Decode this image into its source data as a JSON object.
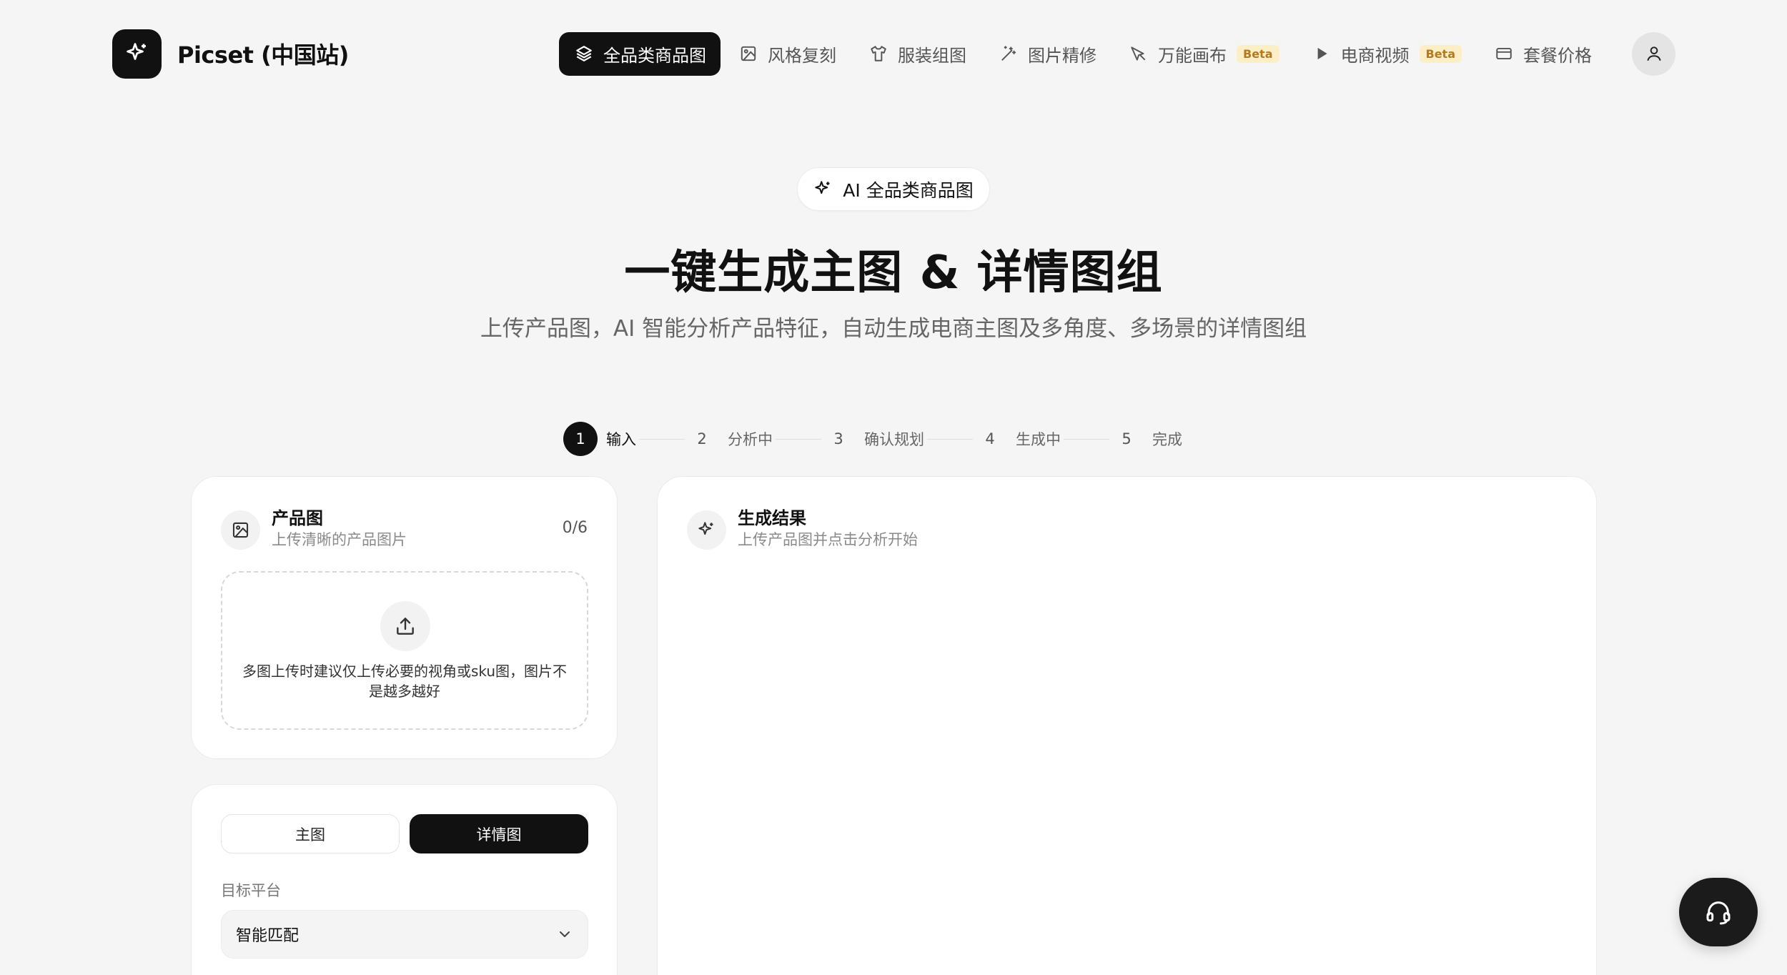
{
  "brand": {
    "name": "Picset (中国站)"
  },
  "nav": {
    "items": [
      {
        "label": "全品类商品图",
        "active": true,
        "icon": "layers-icon"
      },
      {
        "label": "风格复刻",
        "icon": "image-icon"
      },
      {
        "label": "服装组图",
        "icon": "shirt-icon"
      },
      {
        "label": "图片精修",
        "icon": "magic-wand-icon"
      },
      {
        "label": "万能画布",
        "badge": "Beta",
        "icon": "pen-icon"
      },
      {
        "label": "电商视频",
        "badge": "Beta",
        "icon": "play-icon"
      },
      {
        "label": "套餐价格",
        "icon": "card-icon"
      }
    ]
  },
  "hero": {
    "pill": "AI 全品类商品图",
    "title": "一键生成主图 & 详情图组",
    "subtitle": "上传产品图，AI 智能分析产品特征，自动生成电商主图及多角度、多场景的详情图组"
  },
  "steps": [
    {
      "num": "1",
      "label": "输入",
      "active": true
    },
    {
      "num": "2",
      "label": "分析中"
    },
    {
      "num": "3",
      "label": "确认规划"
    },
    {
      "num": "4",
      "label": "生成中"
    },
    {
      "num": "5",
      "label": "完成"
    }
  ],
  "upload": {
    "title": "产品图",
    "subtitle": "上传清晰的产品图片",
    "count": "0/6",
    "hint": "多图上传时建议仅上传必要的视角或sku图，图片不是越多越好"
  },
  "settings": {
    "tab_main": "主图",
    "tab_detail": "详情图",
    "platform_label": "目标平台",
    "platform_value": "智能匹配"
  },
  "result": {
    "title": "生成结果",
    "subtitle": "上传产品图并点击分析开始"
  },
  "colors": {
    "accent": "#111111",
    "background": "#f5f5f5",
    "badge_bg": "#fcefc7",
    "badge_text": "#b7791f"
  }
}
